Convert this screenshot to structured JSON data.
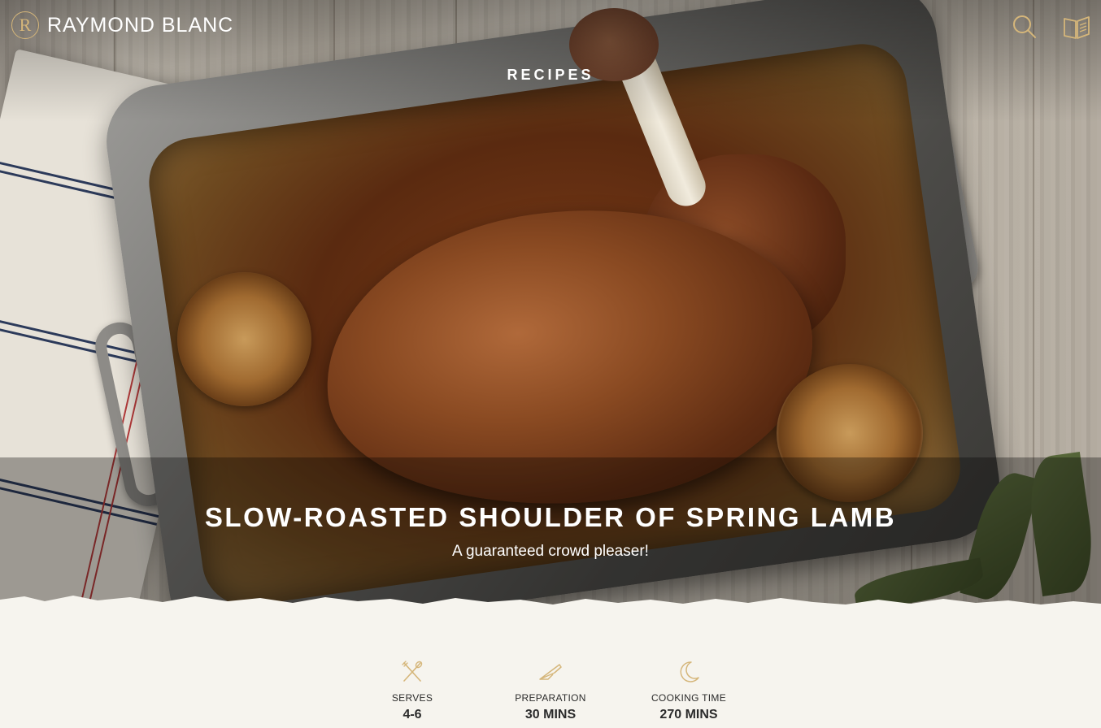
{
  "header": {
    "logo_letter": "R",
    "brand_name": "RAYMOND BLANC",
    "search_icon": "search-icon",
    "book_icon": "book-icon"
  },
  "hero": {
    "section_label": "RECIPES",
    "title": "SLOW-ROASTED SHOULDER OF SPRING LAMB",
    "subtitle": "A guaranteed crowd pleaser!"
  },
  "stats": [
    {
      "icon": "cutlery-icon",
      "label": "SERVES",
      "value": "4-6"
    },
    {
      "icon": "knife-icon",
      "label": "PREPARATION",
      "value": "30 MINS"
    },
    {
      "icon": "moon-icon",
      "label": "COOKING TIME",
      "value": "270 MINS"
    }
  ],
  "colors": {
    "accent_gold": "#d5b67a",
    "page_background": "#f6f4ee",
    "text_dark": "#2b2b2b"
  }
}
